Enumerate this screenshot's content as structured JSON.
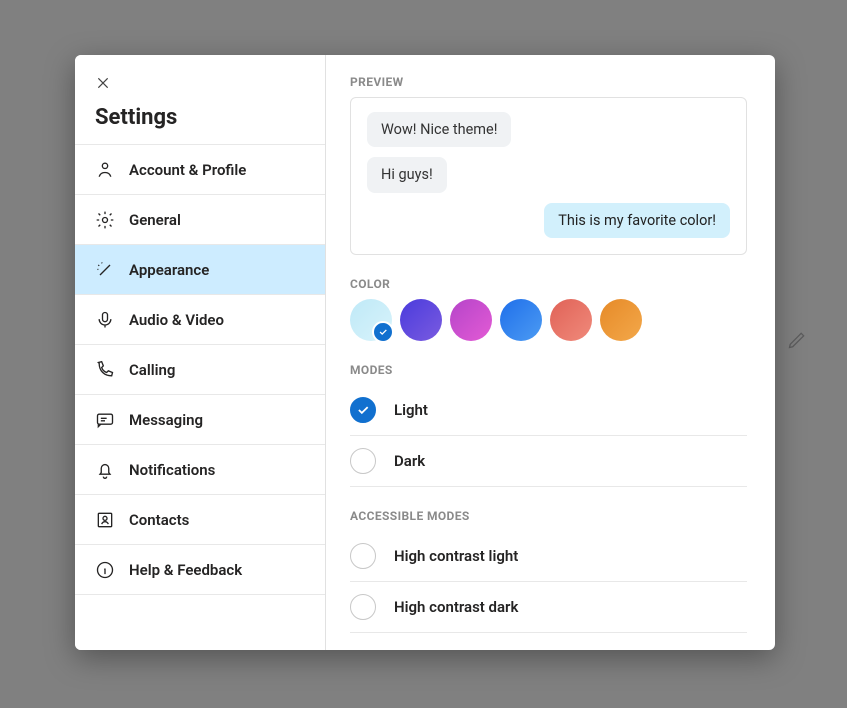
{
  "sidebar": {
    "title": "Settings",
    "items": [
      {
        "label": "Account & Profile",
        "icon": "person-icon"
      },
      {
        "label": "General",
        "icon": "gear-icon"
      },
      {
        "label": "Appearance",
        "icon": "wand-icon",
        "active": true
      },
      {
        "label": "Audio & Video",
        "icon": "microphone-icon"
      },
      {
        "label": "Calling",
        "icon": "phone-icon"
      },
      {
        "label": "Messaging",
        "icon": "chat-icon"
      },
      {
        "label": "Notifications",
        "icon": "bell-icon"
      },
      {
        "label": "Contacts",
        "icon": "contacts-icon"
      },
      {
        "label": "Help & Feedback",
        "icon": "info-icon"
      }
    ]
  },
  "appearance": {
    "preview_label": "PREVIEW",
    "preview_messages": {
      "m1": "Wow! Nice theme!",
      "m2": "Hi guys!",
      "m3": "This is my favorite color!"
    },
    "color_label": "COLOR",
    "colors": [
      {
        "name": "skype-light",
        "css": "linear-gradient(135deg,#bfe9f7,#d8f3fb)",
        "selected": true
      },
      {
        "name": "purple",
        "css": "linear-gradient(135deg,#4a3bdc,#7a5be0)"
      },
      {
        "name": "magenta",
        "css": "linear-gradient(135deg,#b544c9,#e35bd5)"
      },
      {
        "name": "blue",
        "css": "linear-gradient(135deg,#1f6fea,#4c9bf3)"
      },
      {
        "name": "coral",
        "css": "linear-gradient(135deg,#e06257,#f08a7b)"
      },
      {
        "name": "orange",
        "css": "linear-gradient(135deg,#e68a28,#f3a84a)"
      }
    ],
    "modes_label": "MODES",
    "modes": [
      {
        "label": "Light",
        "selected": true
      },
      {
        "label": "Dark",
        "selected": false
      }
    ],
    "accessible_label": "ACCESSIBLE MODES",
    "accessible_modes": [
      {
        "label": "High contrast light",
        "selected": false
      },
      {
        "label": "High contrast dark",
        "selected": false
      }
    ]
  }
}
